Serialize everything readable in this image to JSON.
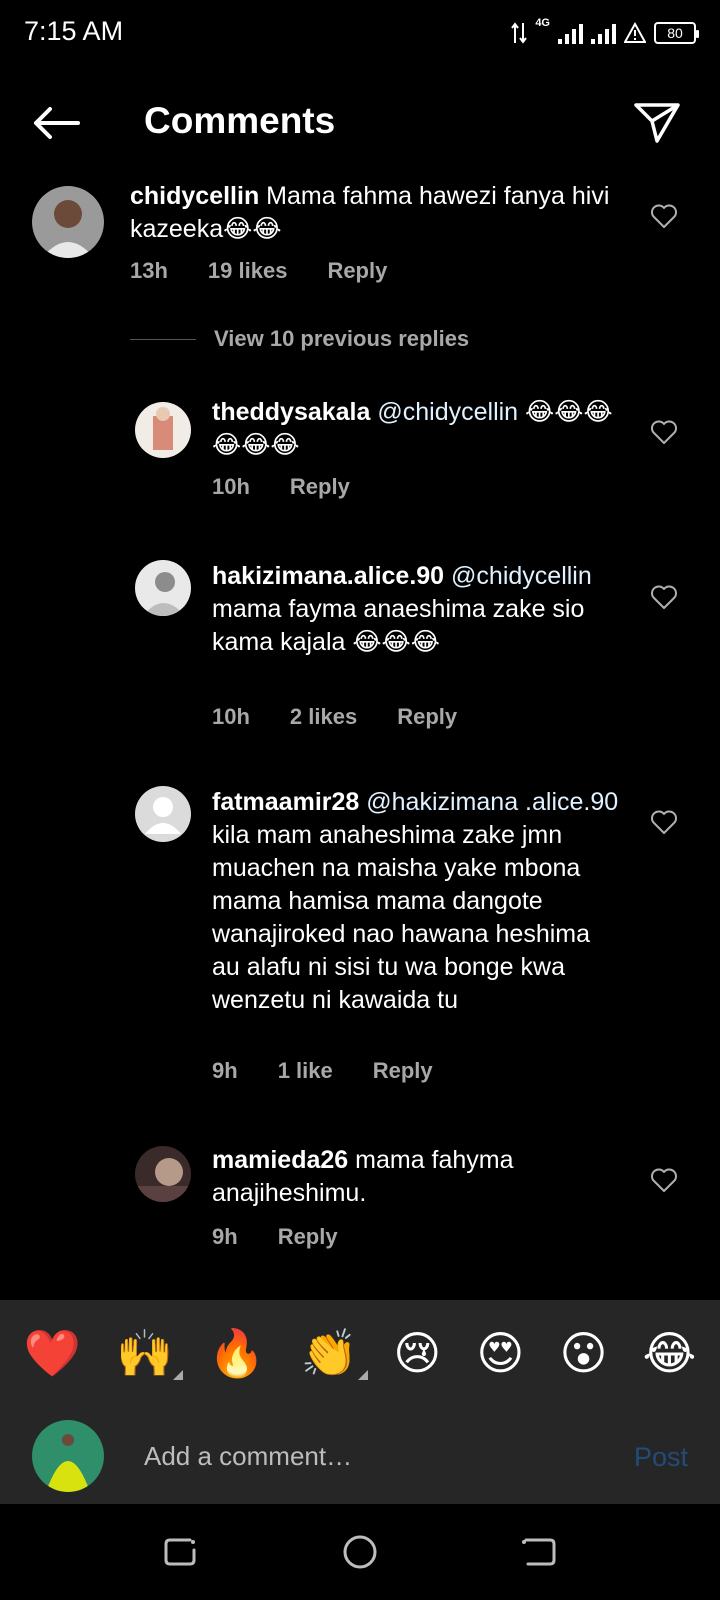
{
  "status": {
    "time": "7:15 AM",
    "network": "4G",
    "battery": "80"
  },
  "header": {
    "title": "Comments"
  },
  "comments": [
    {
      "username": "chidycellin",
      "text": "Mama fahma hawezi fanya hivi kazeeka😂😂",
      "time": "13h",
      "likes": "19 likes",
      "reply": "Reply"
    }
  ],
  "view_replies": "View 10 previous replies",
  "replies": [
    {
      "username": "theddysakala",
      "mention": "@chidycellin",
      "text": " 😂😂😂😂😂😂",
      "time": "10h",
      "likes": "",
      "reply": "Reply"
    },
    {
      "username": "hakizimana.alice.90",
      "mention": "@chidycellin",
      "text": " mama fayma anaeshima zake sio kama kajala 😂😂😂",
      "time": "10h",
      "likes": "2 likes",
      "reply": "Reply"
    },
    {
      "username": "fatmaamir28",
      "mention": "@hakizimana .alice.90",
      "text": " kila mam anaheshima zake jmn muachen na maisha yake mbona mama hamisa mama dangote wanajiroked nao hawana heshima au alafu ni sisi tu wa bonge kwa wenzetu ni kawaida tu",
      "time": "9h",
      "likes": "1 like",
      "reply": "Reply"
    },
    {
      "username": "mamieda26",
      "mention": "",
      "text": " mama fahyma anajiheshimu.",
      "time": "9h",
      "likes": "",
      "reply": "Reply"
    }
  ],
  "reactions": [
    "❤️",
    "🙌",
    "🔥",
    "👏",
    "😢",
    "😍",
    "😮",
    "😂"
  ],
  "composer": {
    "placeholder": "Add a comment…",
    "post_label": "Post"
  },
  "colors": {
    "background": "#000000",
    "panel": "#262626",
    "muted_text": "#a8a8a8",
    "post_disabled": "#234b7a"
  }
}
